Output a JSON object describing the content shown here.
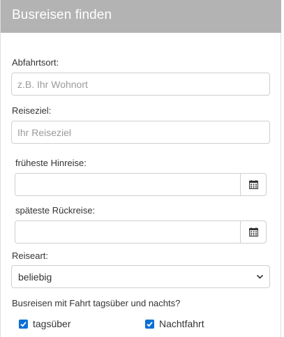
{
  "header": {
    "title": "Busreisen finden"
  },
  "form": {
    "departure": {
      "label": "Abfahrtsort:",
      "placeholder": "z.B. Ihr Wohnort",
      "value": ""
    },
    "destination": {
      "label": "Reiseziel:",
      "placeholder": "Ihr Reiseziel",
      "value": ""
    },
    "earliest_outbound": {
      "label": "früheste Hinreise:",
      "value": "",
      "icon": "calendar-icon"
    },
    "latest_return": {
      "label": "späteste Rückreise:",
      "value": "",
      "icon": "calendar-icon"
    },
    "travel_type": {
      "label": "Reiseart:",
      "selected": "beliebig",
      "icon": "chevron-down-icon"
    },
    "day_night": {
      "question": "Busreisen mit Fahrt tagsüber und nachts?",
      "options": [
        {
          "label": "tagsüber",
          "checked": true
        },
        {
          "label": "Nachtfahrt",
          "checked": true
        }
      ]
    }
  },
  "colors": {
    "header_bg": "#b3b3b3",
    "header_text": "#ffffff",
    "checkbox_accent": "#0a6fd6",
    "input_border": "#cfcfcf"
  }
}
